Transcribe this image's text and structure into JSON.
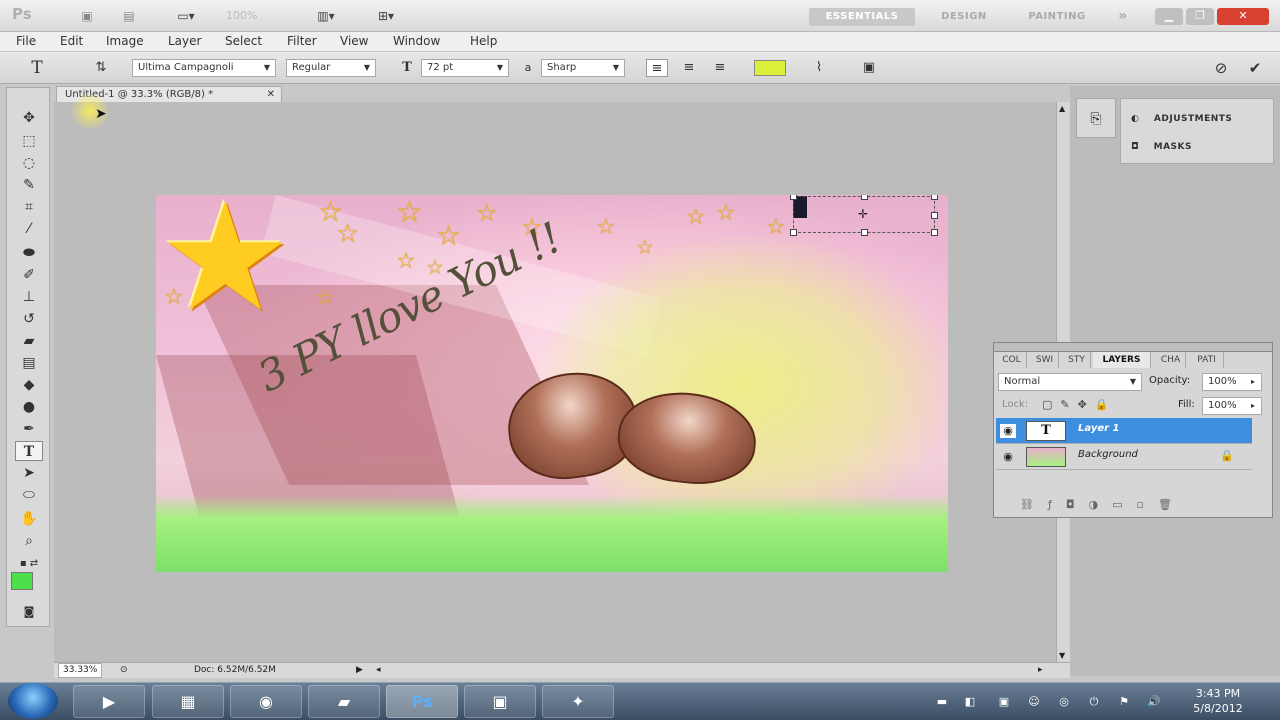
{
  "appbar": {
    "logo": "Ps",
    "zoom": "100%",
    "workspaces": [
      "ESSENTIALS",
      "DESIGN",
      "PAINTING"
    ],
    "more": "»"
  },
  "menu": [
    "File",
    "Edit",
    "Image",
    "Layer",
    "Select",
    "Filter",
    "View",
    "Window",
    "Help"
  ],
  "options": {
    "font_family": "Ultima Campagnoli",
    "font_style": "Regular",
    "font_size": "72 pt",
    "antialias_prefix": "a",
    "antialias": "Sharp",
    "text_color": "#d9ef3a"
  },
  "document": {
    "tab_title": "Untitled-1 @ 33.3% (RGB/8) *",
    "canvas_text": "3 PY llove You !!",
    "status_zoom": "33.33%",
    "status_doc": "Doc: 6.52M/6.52M"
  },
  "panels": {
    "adjustments": "ADJUSTMENTS",
    "masks": "MASKS",
    "layer_tabs": [
      "COL",
      "SWI",
      "STY",
      "LAYERS",
      "CHA",
      "PATI"
    ],
    "blend_mode": "Normal",
    "opacity_label": "Opacity:",
    "opacity": "100%",
    "lock_label": "Lock:",
    "fill_label": "Fill:",
    "fill": "100%",
    "layers": [
      {
        "name": "Layer 1",
        "thumb": "T",
        "selected": true
      },
      {
        "name": "Background",
        "thumb": "",
        "selected": false
      }
    ]
  },
  "taskbar": {
    "time": "3:43 PM",
    "date": "5/8/2012",
    "ps_label": "Ps"
  },
  "colors": {
    "accent": "#3d8ede",
    "foreground": "#4ee04a",
    "background": "#b8f0b0"
  }
}
